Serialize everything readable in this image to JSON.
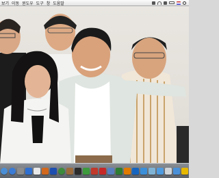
{
  "menubar": {
    "items": [
      "보기",
      "이동",
      "윈도우",
      "도구",
      "창",
      "도움말"
    ],
    "status_icons": [
      "bluetooth-icon",
      "wifi-icon",
      "volume-icon",
      "battery-icon",
      "flag-icon",
      "spotlight-icon"
    ]
  },
  "desktop": {
    "wallpaper": "group-photo-of-six-people"
  },
  "dock": {
    "apps": [
      {
        "name": "finder-icon",
        "color": "#4a8fd6"
      },
      {
        "name": "safari-icon",
        "color": "#3a7bd5"
      },
      {
        "name": "system-icon",
        "color": "#8c8c8c"
      },
      {
        "name": "itunes-icon",
        "color": "#2f6fd0"
      },
      {
        "name": "calendar-icon",
        "color": "#e8e8e8"
      },
      {
        "name": "photo-icon",
        "color": "#d2691e"
      },
      {
        "name": "media-icon",
        "color": "#1e4fb0"
      },
      {
        "name": "chrome-icon",
        "color": "#3c8a3c"
      },
      {
        "name": "contacts-icon",
        "color": "#9b6b3b"
      },
      {
        "name": "game-icon",
        "color": "#2b2b2b"
      },
      {
        "name": "torrent-icon",
        "color": "#3d9a3d"
      },
      {
        "name": "mail-icon",
        "color": "#c0392b"
      },
      {
        "name": "acrobat-icon",
        "color": "#c62828"
      },
      {
        "name": "chart-icon",
        "color": "#5a7fbf"
      },
      {
        "name": "pen-icon",
        "color": "#2e7d32"
      },
      {
        "name": "illustrator-icon",
        "color": "#e07b00"
      },
      {
        "name": "photoshop-icon",
        "color": "#1565c0"
      },
      {
        "name": "folder-icon",
        "color": "#3b8fd9"
      },
      {
        "name": "app-icon",
        "color": "#7fb3d5"
      },
      {
        "name": "folder2-icon",
        "color": "#4f9be0"
      },
      {
        "name": "trash-icon",
        "color": "#cfd4d8"
      },
      {
        "name": "downloads-icon",
        "color": "#4a90d9"
      },
      {
        "name": "stack-icon",
        "color": "#e6b800"
      }
    ]
  }
}
